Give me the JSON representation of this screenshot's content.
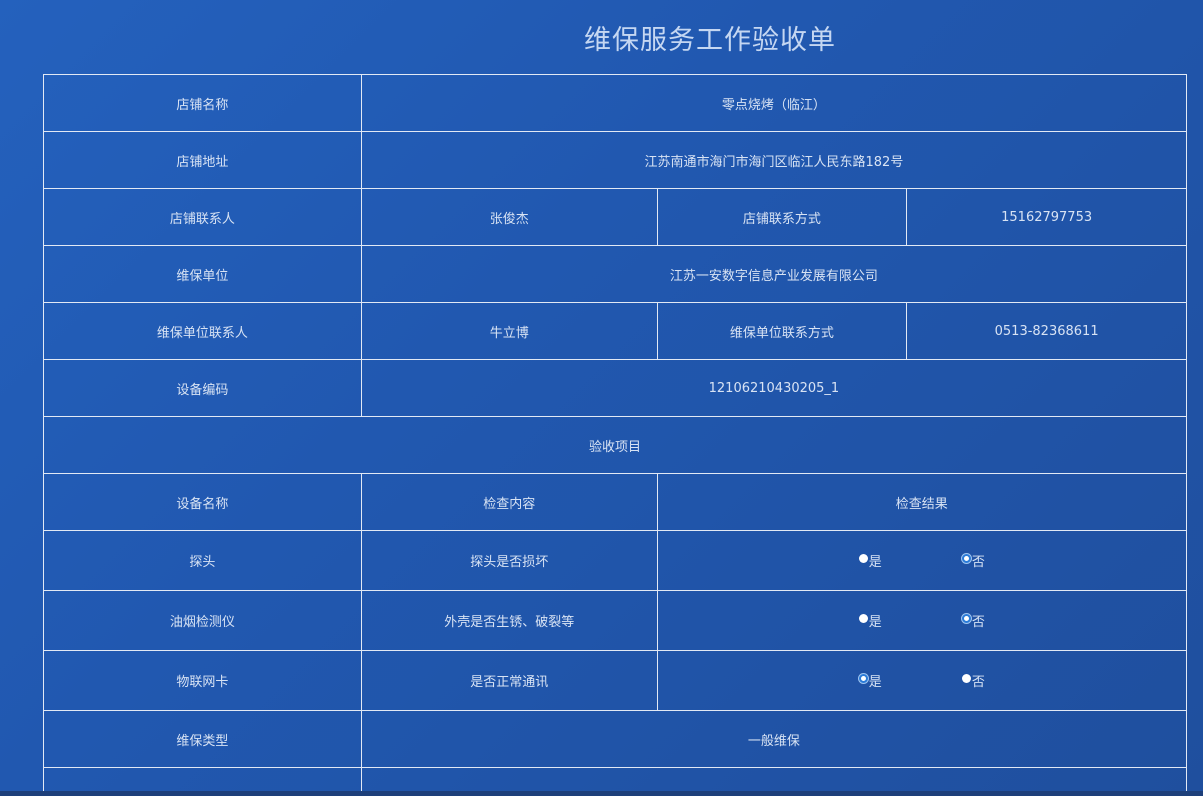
{
  "title": "维保服务工作验收单",
  "shop": {
    "name_label": "店铺名称",
    "name_value": "零点烧烤（临江）",
    "address_label": "店铺地址",
    "address_value": "江苏南通市海门市海门区临江人民东路182号",
    "contact_label": "店铺联系人",
    "contact_value": "张俊杰",
    "phone_label": "店铺联系方式",
    "phone_value": "15162797753"
  },
  "maintainer": {
    "unit_label": "维保单位",
    "unit_value": "江苏一安数字信息产业发展有限公司",
    "contact_label": "维保单位联系人",
    "contact_value": "牛立博",
    "phone_label": "维保单位联系方式",
    "phone_value": "0513-82368611"
  },
  "device_code": {
    "label": "设备编码",
    "value": "12106210430205_1"
  },
  "inspection": {
    "section_title": "验收项目",
    "headers": {
      "device": "设备名称",
      "content": "检查内容",
      "result": "检查结果"
    },
    "yes_label": "是",
    "no_label": "否",
    "items": [
      {
        "device": "探头",
        "content": "探头是否损坏",
        "selected": "否"
      },
      {
        "device": "油烟检测仪",
        "content": "外壳是否生锈、破裂等",
        "selected": "否"
      },
      {
        "device": "物联网卡",
        "content": "是否正常通讯",
        "selected": "是"
      }
    ]
  },
  "maintenance_type": {
    "label": "维保类型",
    "value": "一般维保"
  }
}
